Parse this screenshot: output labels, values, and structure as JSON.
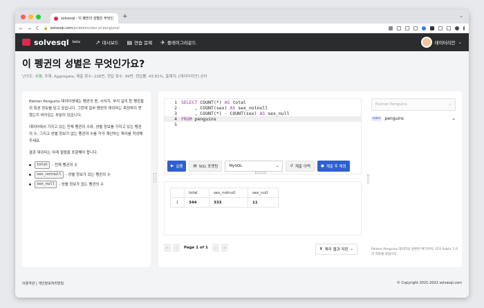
{
  "browser": {
    "tab_title": "solvesql - 이 펭귄의 성별은 무엇인 ×",
    "new_tab": "+",
    "url_host": "solvesql.com",
    "url_path": "/problems/sex-of-penguins/",
    "back": "←",
    "forward": "→",
    "reload": "C",
    "tab_dropdown": "⌄"
  },
  "nav": {
    "logo": "solvesql",
    "logo_sup": "beta",
    "menu": [
      {
        "icon": "↗",
        "label": "대시보드"
      },
      {
        "icon": "▤",
        "label": "연습 문제"
      },
      {
        "icon": "✈",
        "label": "플레이그라운드"
      }
    ],
    "user": "데이터리안",
    "user_chevron": "⌄"
  },
  "problem": {
    "title": "이 펭귄의 성별은 무엇인가요?",
    "meta_prefix": "난이도: ",
    "level": "쉬움",
    "meta_rest": ", 주제: Aggregate, 제출 횟수: 226번, 정답 횟수: 99번, 정답률: 43.81%, 출제자: [데이터리안] 선아",
    "desc": [
      "Palmer Penguins 데이터셋에는 펭귄의 종, 서식지, 부리 길이 등 펭귄들의 특성 정보를 담고 있습니다. 그런데 일부 펭귄의 데이터는 측정하지 못했는지 비어있는 부분이 있습니다.",
      "데이터에서 가지고 있는 전체 펭귄의 수와, 성별 정보를 가지고 있는 펭귄의 수, 그리고 성별 정보가 없는 펭귄의 수를 각각 계산하는 쿼리를 작성해주세요.",
      "결과 데이터는 아래 컬럼을 포함해야 합니다."
    ],
    "columns": [
      {
        "code": "total",
        "desc": "- 전체 펭귄의 수"
      },
      {
        "code": "sex_notnull",
        "desc": "- 성별 정보가 있는 펭귄의 수"
      },
      {
        "code": "sex_null",
        "desc": "- 성별 정보가 없는 펭귄의 수"
      }
    ]
  },
  "editor": {
    "line_numbers": [
      "1",
      "2",
      "3",
      "4",
      "5"
    ],
    "lines": [
      "SELECT COUNT(*) AS total",
      "     , COUNT(sex) AS sex_notnull",
      "     , COUNT(*) - COUNT(sex) AS sex_null",
      "FROM penguins",
      ""
    ]
  },
  "toolbar": {
    "run": "실행",
    "format": "SQL 포맷팅",
    "dialect": "MySQL",
    "history": "제출 이력",
    "submit": "제출 후 채점"
  },
  "results": {
    "headers": [
      "",
      "total",
      "sex_notnull",
      "sex_null"
    ],
    "rows": [
      [
        "1",
        "344",
        "333",
        "11"
      ]
    ],
    "page": "Page 1 of 1",
    "save": "쿼리 결과 저장"
  },
  "sidebar": {
    "dataset_placeholder": "Palmer Penguins",
    "table_badge": "table",
    "table_name": "penguins",
    "note_text": "Palmer Penguins 데이터의 원본은 여기이며, CC0 Public 1.0의 적용을 받습니다."
  },
  "footer": {
    "left": "이용약관 | 개인정보처리방침",
    "right": "© Copyright 2021-2022 solvesql.com"
  },
  "colors": {
    "accent": "#2f5fd0",
    "brand": "#e0284f",
    "easy": "#2ea44f"
  }
}
